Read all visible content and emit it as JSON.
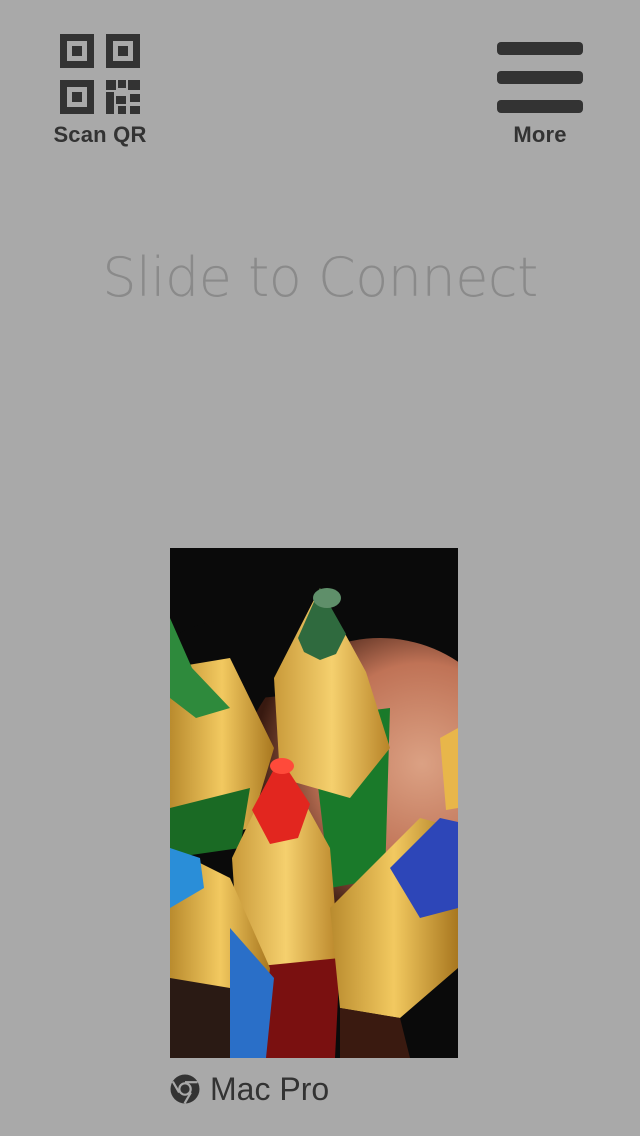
{
  "toolbar": {
    "scan_label": "Scan QR",
    "scan_icon": "qr-code-icon",
    "more_label": "More",
    "more_icon": "hamburger-menu-icon"
  },
  "main": {
    "title": "Slide to Connect"
  },
  "device": {
    "name": "Mac Pro",
    "browser_icon": "chrome-icon"
  },
  "colors": {
    "background": "#a9a9a9",
    "icon_dark": "#333333",
    "title_text": "#8a8a8a"
  }
}
